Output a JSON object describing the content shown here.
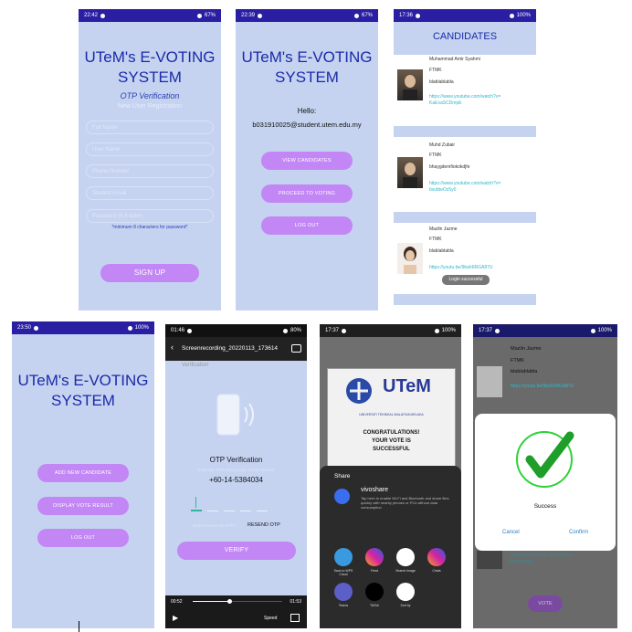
{
  "s1": {
    "time": "22:42",
    "battery": "67%",
    "title_l1": "UTeM's E-VOTING",
    "title_l2": "SYSTEM",
    "otp": "OTP Verification",
    "newuser": "New User Registration",
    "fields": [
      "Full Name",
      "User Name",
      "Phone Number",
      "Student Email",
      "Password (6-8 letter)"
    ],
    "hint": "*minimum 8 characters for password*",
    "signup": "SIGN UP"
  },
  "s2": {
    "time": "22:39",
    "battery": "67%",
    "title_l1": "UTeM's E-VOTING",
    "title_l2": "SYSTEM",
    "hello": "Hello:",
    "email": "b031910025@student.utem.edu.my",
    "btn1": "VIEW CANDIDATES",
    "btn2": "PROCEED TO VOTING",
    "btn3": "LOG OUT"
  },
  "s3": {
    "time": "17:36",
    "battery": "100%",
    "header": "CANDIDATES",
    "cands": [
      {
        "name": "Muhammad Amir Syahmi",
        "fac": "FTMK",
        "desc": "blablablabla",
        "link1": "https://www.youtube.com/watch?v=",
        "link2": "KaExaSCDmpE"
      },
      {
        "name": "Muhd Zubair",
        "fac": "FTMK",
        "desc": "bhaygdemfiokokdjfe",
        "link1": "https://www.youtube.com/watch?v=",
        "link2": "bxutbeOz5y0"
      },
      {
        "name": "Mazlin Jazme",
        "fac": "FTMK",
        "desc": "blablablabla",
        "link1": "https://youtu.be/9bah6RGA87U",
        "link2": ""
      }
    ],
    "toast": "Login successful"
  },
  "s4": {
    "time": "23:50",
    "battery": "100%",
    "title_l1": "UTeM's E-VOTING",
    "title_l2": "SYSTEM",
    "btn1": "ADD NEW CANDIDATE",
    "btn2": "DISPLAY VOTE RESULT",
    "btn3": "LOG OUT"
  },
  "s5": {
    "time": "01:46",
    "battery": "80%",
    "filename": "Screenrecording_20220113_173614",
    "under": "Verification",
    "otp_title": "OTP Verification",
    "otp_sub": "Enter the OTP sent to your mobile number",
    "phone": "+60-14-5384034",
    "resend_q": "Didn't receive the OTP?",
    "resend": "RESEND OTP",
    "verify": "VERIFY",
    "t_start": "00:52",
    "t_end": "01:53",
    "speed": "Speed",
    "progress": 0.41
  },
  "s6": {
    "time": "17:37",
    "battery": "100%",
    "utem": "UTeM",
    "uni": "UNIVERSITI TEKNIKAL MALAYSIA MELAKA",
    "congrats1": "CONGRATULATIONS!",
    "congrats2": "YOUR VOTE IS",
    "congrats3": "SUCCESSFUL",
    "share": "Share",
    "vivo": "vivoshare",
    "vivo_desc": "Tap here to enable Wi-Fi and Bluetooth and share files quickly with nearby phones or PCs without data consumption",
    "apps1": [
      "Save to WPS Cloud",
      "Feed",
      "Search image",
      "Chats"
    ],
    "apps2": [
      "Teams",
      "TikTok",
      "Sort by"
    ]
  },
  "s7": {
    "time": "17:37",
    "battery": "100%",
    "name": "Mazlin Jazme",
    "fac": "FTMK",
    "desc": "blablablabla",
    "link": "https://youtu.be/9bah6RGA87U",
    "success": "Success",
    "cancel": "Cancel",
    "confirm": "Confirm",
    "link_b1": "https://www.youtube.com/watch?v=",
    "link_b2": "bxutbeOz5y0",
    "vote": "VOTE"
  }
}
